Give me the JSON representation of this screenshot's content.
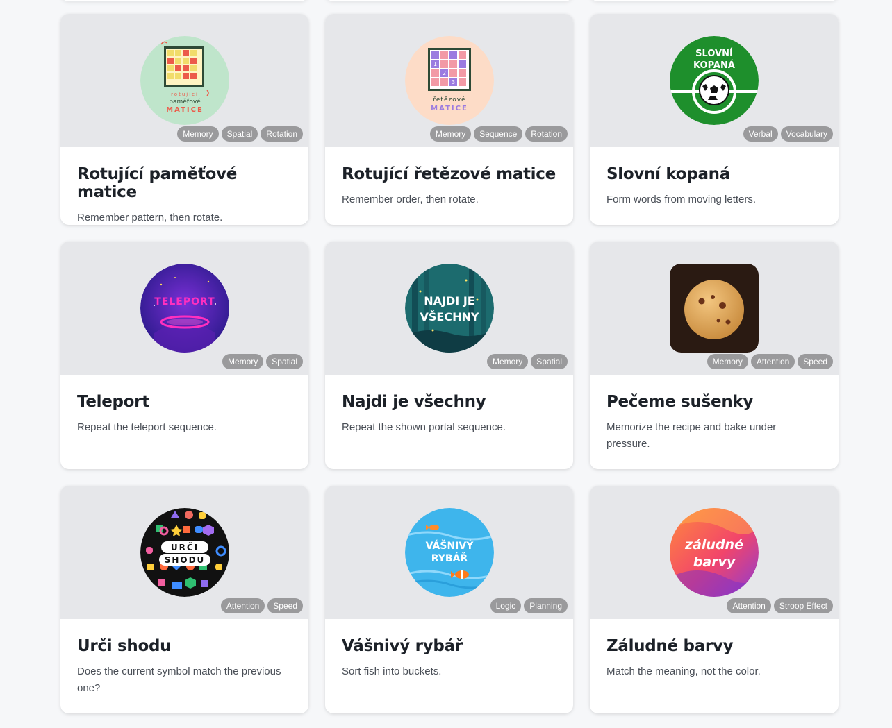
{
  "games": [
    {
      "title": "Rotující paměťové matice",
      "description": "Remember pattern, then rotate.",
      "tags": [
        "Memory",
        "Spatial",
        "Rotation"
      ],
      "logo_text": [
        "rotující",
        "paměťové",
        "MATICE"
      ]
    },
    {
      "title": "Rotující řetězové matice",
      "description": "Remember order, then rotate.",
      "tags": [
        "Memory",
        "Sequence",
        "Rotation"
      ],
      "logo_text": [
        "řetězové",
        "MATICE",
        "1",
        "2",
        "3"
      ]
    },
    {
      "title": "Slovní kopaná",
      "description": "Form words from moving letters.",
      "tags": [
        "Verbal",
        "Vocabulary"
      ],
      "logo_text": [
        "SLOVNÍ",
        "KOPANÁ"
      ]
    },
    {
      "title": "Teleport",
      "description": "Repeat the teleport sequence.",
      "tags": [
        "Memory",
        "Spatial"
      ],
      "logo_text": [
        "TELEPORT"
      ]
    },
    {
      "title": "Najdi je všechny",
      "description": "Repeat the shown portal sequence.",
      "tags": [
        "Memory",
        "Spatial"
      ],
      "logo_text": [
        "NAJDI JE",
        "VŠECHNY"
      ]
    },
    {
      "title": "Pečeme sušenky",
      "description": "Memorize the recipe and bake under pressure.",
      "tags": [
        "Memory",
        "Attention",
        "Speed"
      ],
      "logo_text": []
    },
    {
      "title": "Urči shodu",
      "description": "Does the current symbol match the previous one?",
      "tags": [
        "Attention",
        "Speed"
      ],
      "logo_text": [
        "URČI",
        "SHODU"
      ]
    },
    {
      "title": "Vášnivý rybář",
      "description": "Sort fish into buckets.",
      "tags": [
        "Logic",
        "Planning"
      ],
      "logo_text": [
        "VÁŠNIVÝ",
        "RYBÁŘ"
      ]
    },
    {
      "title": "Záludné barvy",
      "description": "Match the meaning, not the color.",
      "tags": [
        "Attention",
        "Stroop Effect"
      ],
      "logo_text": [
        "záludné",
        "barvy"
      ]
    }
  ],
  "colors": {
    "page_bg": "#f6f7f9",
    "thumb_bg": "#e6e7ea",
    "tag_bg": "#9a9a9c",
    "title": "#1c2128",
    "desc": "#4a4f57"
  }
}
